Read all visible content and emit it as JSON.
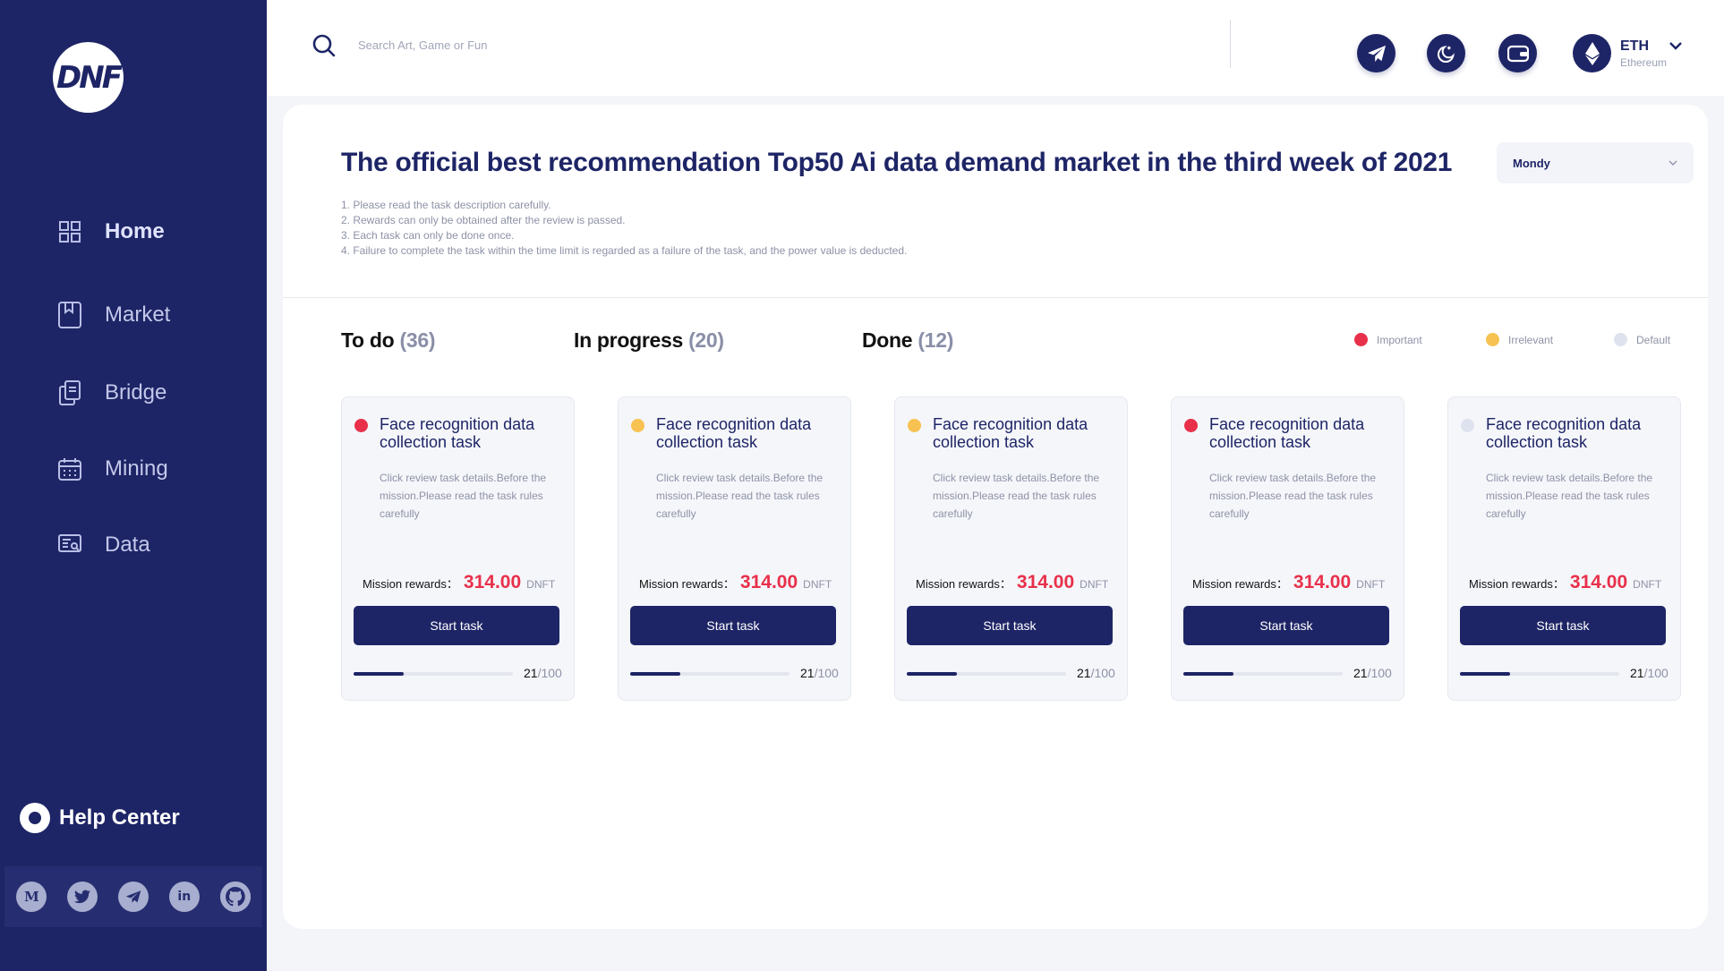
{
  "sidebar": {
    "logo_text": "DNF",
    "items": [
      {
        "label": "Home",
        "icon": "grid-icon"
      },
      {
        "label": "Market",
        "icon": "bookmark-icon"
      },
      {
        "label": "Bridge",
        "icon": "copy-icon"
      },
      {
        "label": "Mining",
        "icon": "calendar-icon"
      },
      {
        "label": "Data",
        "icon": "data-icon"
      }
    ],
    "help_center": "Help Center",
    "socials": [
      {
        "name": "medium",
        "glyph": "M"
      },
      {
        "name": "twitter",
        "glyph": ""
      },
      {
        "name": "telegram",
        "glyph": ""
      },
      {
        "name": "linkedin",
        "glyph": "in"
      },
      {
        "name": "github",
        "glyph": ""
      }
    ]
  },
  "topbar": {
    "search_placeholder": "Search Art, Game or Fun",
    "network": {
      "symbol": "ETH",
      "name": "Ethereum"
    }
  },
  "main": {
    "title": "The official best recommendation Top50 Ai data demand market in the third week of 2021",
    "select_value": "Mondy",
    "rules": [
      "1. Please read the task description carefully.",
      "2. Rewards can only be obtained after the review is passed.",
      "3. Each task can only be done once.",
      "4. Failure to complete the task within the time limit is regarded as a failure of the task, and the power value is deducted."
    ],
    "columns": [
      {
        "label": "To do",
        "count": "(36)"
      },
      {
        "label": "In progress",
        "count": "(20)"
      },
      {
        "label": "Done",
        "count": "(12)"
      }
    ],
    "legend": [
      {
        "label": "Important",
        "color": "#e8304a"
      },
      {
        "label": "Irrelevant",
        "color": "#f7c251"
      },
      {
        "label": "Default",
        "color": "#dde2ee"
      }
    ]
  },
  "tasks": [
    {
      "title": "Face recognition data collection task",
      "desc": "Click review task details.Before the mission.Please read the task rules carefully",
      "reward_label": "Mission rewards：",
      "amount": "314.00",
      "unit": "DNFT",
      "button": "Start task",
      "done": "21",
      "total": "/100",
      "progress": 0.21,
      "priority_color": "#e8304a"
    },
    {
      "title": "Face recognition data collection task",
      "desc": "Click review task details.Before the mission.Please read the task rules carefully",
      "reward_label": "Mission rewards：",
      "amount": "314.00",
      "unit": "DNFT",
      "button": "Start task",
      "done": "21",
      "total": "/100",
      "progress": 0.21,
      "priority_color": "#f7c251"
    },
    {
      "title": "Face recognition data collection task",
      "desc": "Click review task details.Before the mission.Please read the task rules carefully",
      "reward_label": "Mission rewards：",
      "amount": "314.00",
      "unit": "DNFT",
      "button": "Start task",
      "done": "21",
      "total": "/100",
      "progress": 0.21,
      "priority_color": "#f7c251"
    },
    {
      "title": "Face recognition data collection task",
      "desc": "Click review task details.Before the mission.Please read the task rules carefully",
      "reward_label": "Mission rewards：",
      "amount": "314.00",
      "unit": "DNFT",
      "button": "Start task",
      "done": "21",
      "total": "/100",
      "progress": 0.21,
      "priority_color": "#e8304a"
    },
    {
      "title": "Face recognition data collection task",
      "desc": "Click review task details.Before the mission.Please read the task rules carefully",
      "reward_label": "Mission rewards：",
      "amount": "314.00",
      "unit": "DNFT",
      "button": "Start task",
      "done": "21",
      "total": "/100",
      "progress": 0.21,
      "priority_color": "#dde2ee"
    }
  ]
}
